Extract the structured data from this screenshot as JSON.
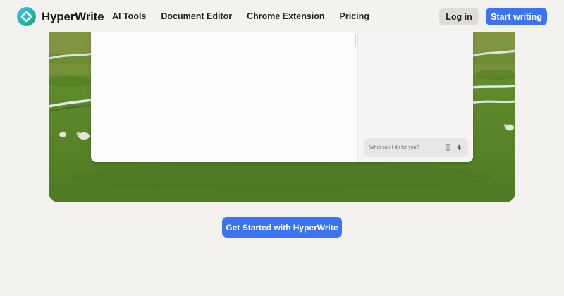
{
  "brand": {
    "name": "HyperWrite",
    "logo_icon": "hyperwrite-logo-icon"
  },
  "nav": {
    "items": [
      {
        "label": "AI Tools"
      },
      {
        "label": "Document Editor"
      },
      {
        "label": "Chrome Extension"
      },
      {
        "label": "Pricing"
      }
    ]
  },
  "auth": {
    "login_label": "Log in",
    "start_label": "Start writing"
  },
  "app_preview": {
    "chat_placeholder": "What can I do for you?",
    "icons": [
      "document-icon",
      "microphone-icon"
    ]
  },
  "cta": {
    "label": "Get Started with HyperWrite"
  },
  "colors": {
    "accent": "#3b73f0",
    "background": "#f3f2ef",
    "login_bg": "#dedcd8",
    "grass": "#5a8a2c"
  }
}
